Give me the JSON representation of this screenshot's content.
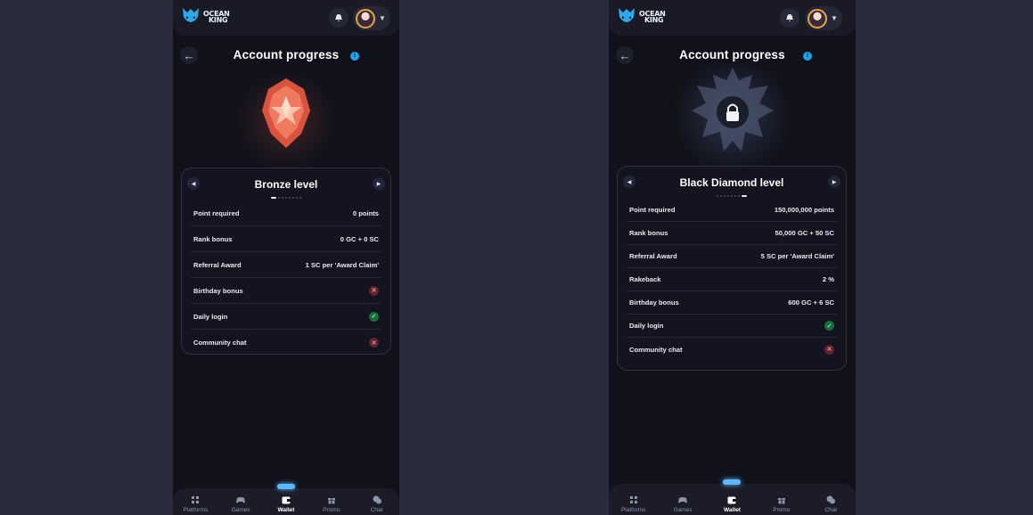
{
  "app": {
    "logo_line1": "OCEAN",
    "logo_line2": "KING",
    "brand_color": "#1fa3e6"
  },
  "left": {
    "title": "Account progress",
    "level_name": "Bronze level",
    "dots_total": 8,
    "dots_active": 0,
    "badge_icon": "bronze-badge-icon",
    "rows": [
      {
        "label": "Point required",
        "value": "0 points"
      },
      {
        "label": "Rank bonus",
        "value": "0 GC + 0 SC"
      },
      {
        "label": "Referral Award",
        "value": "1 SC per 'Award Claim'"
      },
      {
        "label": "Birthday bonus",
        "mark": "no"
      },
      {
        "label": "Daily login",
        "mark": "yes"
      },
      {
        "label": "Community chat",
        "mark": "no"
      }
    ]
  },
  "right": {
    "title": "Account progress",
    "level_name": "Black Diamond level",
    "dots_total": 8,
    "dots_active": 7,
    "badge_icon": "locked-badge-icon",
    "rows": [
      {
        "label": "Point required",
        "value": "150,000,000 points"
      },
      {
        "label": "Rank bonus",
        "value": "50,000 GC + 50 SC"
      },
      {
        "label": "Referral Award",
        "value": "5 SC per 'Award Claim'"
      },
      {
        "label": "Rakeback",
        "value": "2 %"
      },
      {
        "label": "Birthday bonus",
        "value": "600 GC + 6 SC"
      },
      {
        "label": "Daily login",
        "mark": "yes"
      },
      {
        "label": "Community chat",
        "mark": "no"
      }
    ]
  },
  "nav": {
    "items": [
      {
        "label": "Platforms",
        "icon": "platforms-icon"
      },
      {
        "label": "Games",
        "icon": "gamepad-icon"
      },
      {
        "label": "Wallet",
        "icon": "wallet-icon",
        "active": true
      },
      {
        "label": "Promo",
        "icon": "gift-icon"
      },
      {
        "label": "Chat",
        "icon": "chat-icon"
      }
    ]
  }
}
